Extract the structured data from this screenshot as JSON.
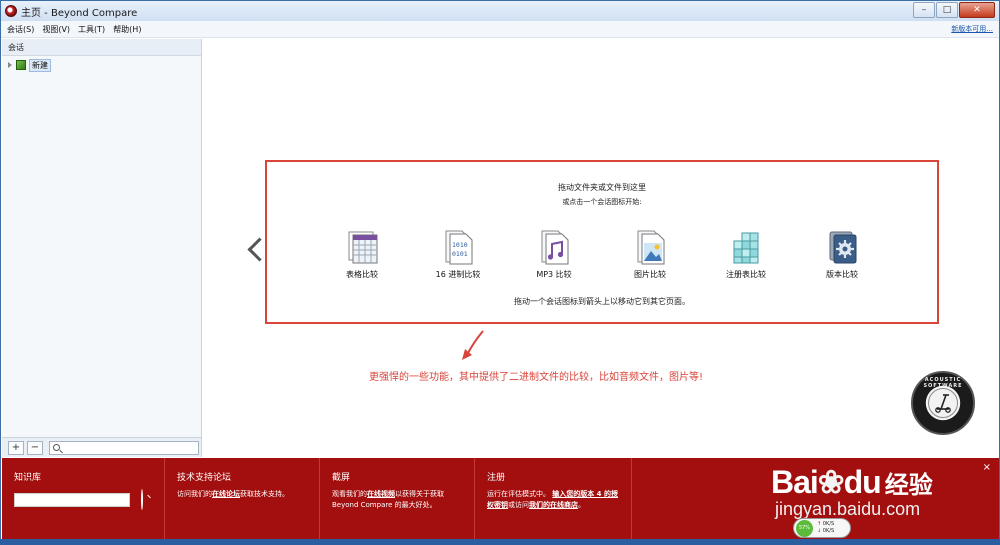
{
  "window": {
    "title": "主页 - Beyond Compare"
  },
  "menu": {
    "items": [
      "会话(S)",
      "视图(V)",
      "工具(T)",
      "帮助(H)"
    ],
    "new_version_link": "新版本可用..."
  },
  "sidebar": {
    "header": "会话",
    "tree": [
      {
        "label": "新建"
      }
    ],
    "footer": {
      "add": "+",
      "remove": "−"
    }
  },
  "main": {
    "drop_line1": "拖动文件夹或文件到这里",
    "drop_line2": "或点击一个会话图标开始:",
    "sessions": [
      {
        "label": "表格比较",
        "icon": "table-compare-icon"
      },
      {
        "label": "16 进制比较",
        "icon": "hex-compare-icon"
      },
      {
        "label": "MP3 比较",
        "icon": "mp3-compare-icon"
      },
      {
        "label": "图片比较",
        "icon": "picture-compare-icon"
      },
      {
        "label": "注册表比较",
        "icon": "registry-compare-icon"
      },
      {
        "label": "版本比较",
        "icon": "version-compare-icon"
      }
    ],
    "drop_hint": "拖动一个会话图标到箭头上以移动它到其它页面。",
    "annotation": "更强悍的一些功能，其中提供了二进制文件的比较，比如音频文件，图片等!"
  },
  "badge": {
    "ring_text": "ACOUSTIC SOFTWARE"
  },
  "infobar": {
    "knowledge": {
      "title": "知识库"
    },
    "forum": {
      "title": "技术支持论坛",
      "text_before": "访问我们的",
      "link": "在线论坛",
      "text_after": "获取技术支持。"
    },
    "screencast": {
      "title": "截屏",
      "text_before": "观看我们的",
      "link": "在线视频",
      "text_after": "以获得关于获取 Beyond Compare 的最大好处。"
    },
    "register": {
      "title": "注册",
      "text_before": "运行在评估模式中。",
      "link1": "输入您的版本 4 的授权密钥",
      "text_mid": "或访问",
      "link2": "我们的在线商店",
      "text_after": "。"
    },
    "close": "×"
  },
  "watermark": {
    "logo": "Bai",
    "logo_tail": "du",
    "cn": "经验",
    "url": "jingyan.baidu.com"
  },
  "net_widget": {
    "percent": "57%",
    "up": "0K/S",
    "down": "0K/S"
  },
  "colors": {
    "frame_red": "#d9443b",
    "infobar_red": "#a30e0e"
  }
}
